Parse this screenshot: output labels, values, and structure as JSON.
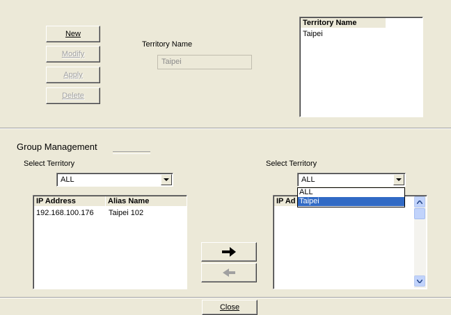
{
  "buttons": {
    "new": "New",
    "modify": "Modify",
    "apply": "Apply",
    "delete": "Delete",
    "close": "Close"
  },
  "territory_form": {
    "label": "Territory Name",
    "value": "Taipei"
  },
  "territory_list": {
    "header": "Territory Name",
    "items": [
      "Taipei"
    ]
  },
  "group_management": {
    "title": "Group Management",
    "left": {
      "select_label": "Select Territory",
      "select_value": "ALL",
      "columns": [
        "IP Address",
        "Alias Name"
      ],
      "rows": [
        {
          "ip": "192.168.100.176",
          "alias": "Taipei 102"
        }
      ]
    },
    "right": {
      "select_label": "Select Territory",
      "select_value": "ALL",
      "dropdown_options": [
        "ALL",
        "Taipei"
      ],
      "dropdown_selected": "Taipei",
      "column_visible": "IP Ad"
    }
  },
  "icons": {
    "move_right": "arrow-right-icon",
    "move_left": "arrow-left-icon",
    "combo_arrow": "chevron-down-icon"
  }
}
